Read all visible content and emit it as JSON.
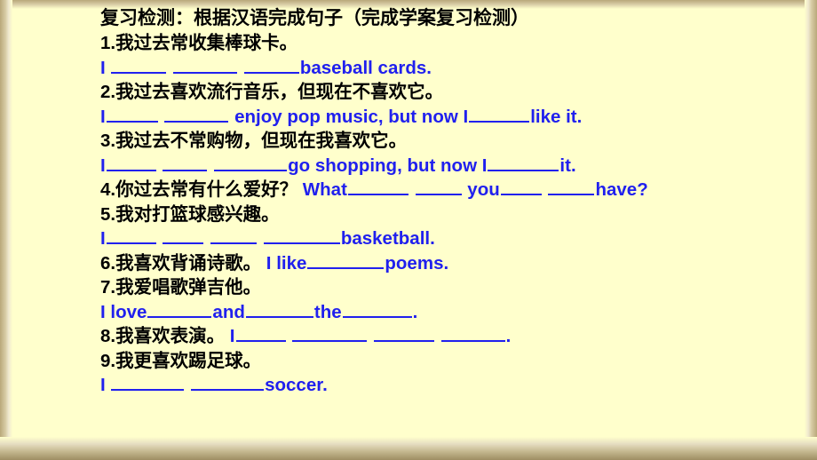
{
  "slide": {
    "background_color": "#ffffcc",
    "text_color_chinese": "#000000",
    "text_color_english": "#2020ee",
    "title": "复习检测：根据汉语完成句子（完成学案复习检测）",
    "items": [
      {
        "number": "1.",
        "chinese": "1.我过去常收集棒球卡。",
        "english_parts": [
          {
            "type": "text",
            "value": "I "
          },
          {
            "type": "blank",
            "width": 62
          },
          {
            "type": "text",
            "value": " "
          },
          {
            "type": "blank",
            "width": 72
          },
          {
            "type": "text",
            "value": " "
          },
          {
            "type": "blank",
            "width": 62
          },
          {
            "type": "text",
            "value": "baseball cards."
          }
        ]
      },
      {
        "number": "2.",
        "chinese": "2.我过去喜欢流行音乐，但现在不喜欢它。",
        "english_parts": [
          {
            "type": "text",
            "value": "I"
          },
          {
            "type": "blank",
            "width": 58
          },
          {
            "type": "text",
            "value": " "
          },
          {
            "type": "blank",
            "width": 72
          },
          {
            "type": "text",
            "value": " enjoy pop music, but now I"
          },
          {
            "type": "blank",
            "width": 68
          },
          {
            "type": "text",
            "value": "like it."
          }
        ]
      },
      {
        "number": "3.",
        "chinese": "3.我过去不常购物，但现在我喜欢它。",
        "english_parts": [
          {
            "type": "text",
            "value": "I"
          },
          {
            "type": "blank",
            "width": 56
          },
          {
            "type": "text",
            "value": " "
          },
          {
            "type": "blank",
            "width": 50
          },
          {
            "type": "text",
            "value": " "
          },
          {
            "type": "blank",
            "width": 82
          },
          {
            "type": "text",
            "value": "go shopping, but now I"
          },
          {
            "type": "blank",
            "width": 80
          },
          {
            "type": "text",
            "value": "it."
          }
        ]
      },
      {
        "number": "4.",
        "chinese": "4.你过去常有什么爱好？",
        "english_parts": [
          {
            "type": "text",
            "value": " What"
          },
          {
            "type": "blank",
            "width": 68
          },
          {
            "type": "text",
            "value": " "
          },
          {
            "type": "blank",
            "width": 52
          },
          {
            "type": "text",
            "value": " you"
          },
          {
            "type": "blank",
            "width": 46
          },
          {
            "type": "text",
            "value": " "
          },
          {
            "type": "blank",
            "width": 52
          },
          {
            "type": "text",
            "value": "have?"
          }
        ],
        "inline": true
      },
      {
        "number": "5.",
        "chinese": "5.我对打篮球感兴趣。",
        "english_parts": [
          {
            "type": "text",
            "value": "I"
          },
          {
            "type": "blank",
            "width": 56
          },
          {
            "type": "text",
            "value": " "
          },
          {
            "type": "blank",
            "width": 46
          },
          {
            "type": "text",
            "value": " "
          },
          {
            "type": "blank",
            "width": 52
          },
          {
            "type": "text",
            "value": " "
          },
          {
            "type": "blank",
            "width": 86
          },
          {
            "type": "text",
            "value": "basketball."
          }
        ]
      },
      {
        "number": "6.",
        "chinese": "6.我喜欢背诵诗歌。",
        "english_parts": [
          {
            "type": "text",
            "value": " I like"
          },
          {
            "type": "blank",
            "width": 86
          },
          {
            "type": "text",
            "value": "poems."
          }
        ],
        "inline": true
      },
      {
        "number": "7.",
        "chinese": "7.我爱唱歌弹吉他。",
        "english_parts": [
          {
            "type": "text",
            "value": "I love"
          },
          {
            "type": "blank",
            "width": 72
          },
          {
            "type": "text",
            "value": "and"
          },
          {
            "type": "blank",
            "width": 76
          },
          {
            "type": "text",
            "value": "the"
          },
          {
            "type": "blank",
            "width": 78
          },
          {
            "type": "text",
            "value": "."
          }
        ]
      },
      {
        "number": "8.",
        "chinese": "8.我喜欢表演。",
        "english_parts": [
          {
            "type": "text",
            "value": " I"
          },
          {
            "type": "blank",
            "width": 56
          },
          {
            "type": "text",
            "value": " "
          },
          {
            "type": "blank",
            "width": 84
          },
          {
            "type": "text",
            "value": " "
          },
          {
            "type": "blank",
            "width": 68
          },
          {
            "type": "text",
            "value": " "
          },
          {
            "type": "blank",
            "width": 72
          },
          {
            "type": "text",
            "value": "."
          }
        ],
        "inline": true
      },
      {
        "number": "9.",
        "chinese": "9.我更喜欢踢足球。",
        "english_parts": [
          {
            "type": "text",
            "value": "I "
          },
          {
            "type": "blank",
            "width": 82
          },
          {
            "type": "text",
            "value": " "
          },
          {
            "type": "blank",
            "width": 82
          },
          {
            "type": "text",
            "value": "soccer."
          }
        ]
      }
    ]
  }
}
